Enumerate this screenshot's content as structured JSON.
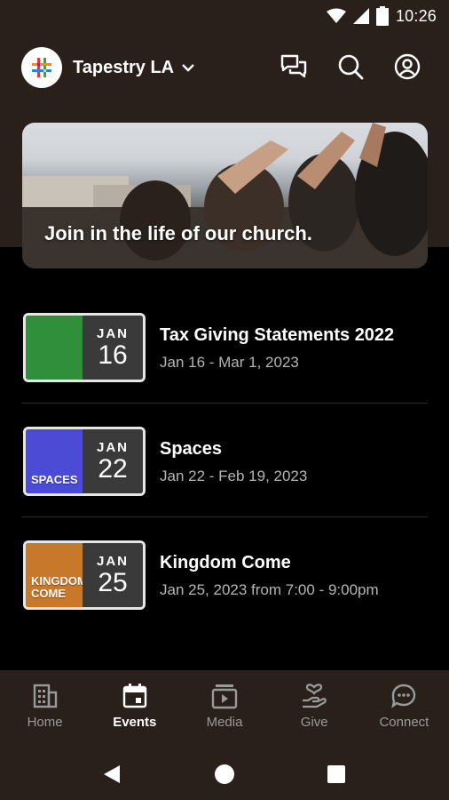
{
  "status_bar": {
    "time": "10:26",
    "icons": [
      "wifi-icon",
      "signal-icon",
      "battery-icon"
    ]
  },
  "header": {
    "org_name": "Tapestry LA",
    "actions": [
      "chat-icon",
      "search-icon",
      "profile-icon"
    ]
  },
  "hero": {
    "text": "Join in the life of our church."
  },
  "events": [
    {
      "month": "JAN",
      "day": "16",
      "title": "Tax Giving Statements 2022",
      "dates": "Jan 16 - Mar 1, 2023",
      "thumb_color": "#2f8f3b",
      "thumb_word": ""
    },
    {
      "month": "JAN",
      "day": "22",
      "title": "Spaces",
      "dates": "Jan 22 - Feb 19, 2023",
      "thumb_color": "#4c4bd6",
      "thumb_word": "SPACES"
    },
    {
      "month": "JAN",
      "day": "25",
      "title": "Kingdom Come",
      "dates": "Jan 25, 2023 from 7:00 - 9:00pm",
      "thumb_color": "#c8782a",
      "thumb_word": "KINGDOM COME"
    }
  ],
  "bottom_nav": [
    {
      "label": "Home",
      "icon": "building-icon",
      "active": false
    },
    {
      "label": "Events",
      "icon": "calendar-icon",
      "active": true
    },
    {
      "label": "Media",
      "icon": "media-icon",
      "active": false
    },
    {
      "label": "Give",
      "icon": "give-icon",
      "active": false
    },
    {
      "label": "Connect",
      "icon": "chat-bubble-icon",
      "active": false
    }
  ],
  "colors": {
    "header_bg": "#2a201b",
    "page_bg": "#000000",
    "accent": "#ffffff"
  }
}
